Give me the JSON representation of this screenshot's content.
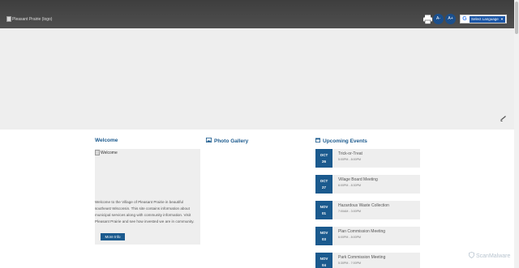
{
  "header": {
    "logo_alt": "Pleasant Prairie (logo)",
    "font_decrease": "A-",
    "font_increase": "A+",
    "language": {
      "google_letter": "G",
      "select_label": "Select Language",
      "caret": "▼"
    }
  },
  "welcome": {
    "heading": "Welcome",
    "image_alt": "Welcome",
    "text": "Welcome to the Village of Pleasant Prairie in beautiful southeast Wisconsin. This site contains information about municipal services along with community information. Visit Pleasant Prairie and see how invested we are in community.",
    "button": "More Info"
  },
  "gallery": {
    "heading": "Photo Gallery"
  },
  "events": {
    "heading": "Upcoming Events",
    "items": [
      {
        "month": "OCT",
        "day": "26",
        "title": "Trick-or-Treat",
        "time": "5:00PM - 8:00PM"
      },
      {
        "month": "OCT",
        "day": "27",
        "title": "Village Board Meeting",
        "time": "6:00PM - 8:30PM"
      },
      {
        "month": "NOV",
        "day": "01",
        "title": "Hazardous Waste Collection",
        "time": "7:00AM - 3:00PM"
      },
      {
        "month": "NOV",
        "day": "03",
        "title": "Plan Commission Meeting",
        "time": "6:00PM - 8:00PM"
      },
      {
        "month": "NOV",
        "day": "04",
        "title": "Park Commission Meeting",
        "time": "5:30PM - 7:00PM"
      }
    ]
  },
  "watermark": "ScanMalware",
  "colors": {
    "header": "#444444",
    "accent": "#1b5a8e",
    "hero": "#eeeeee",
    "card": "#eeeeee"
  },
  "icons": [
    "print-icon",
    "image-icon",
    "calendar-icon",
    "check-icon",
    "google-icon",
    "shield-icon"
  ]
}
